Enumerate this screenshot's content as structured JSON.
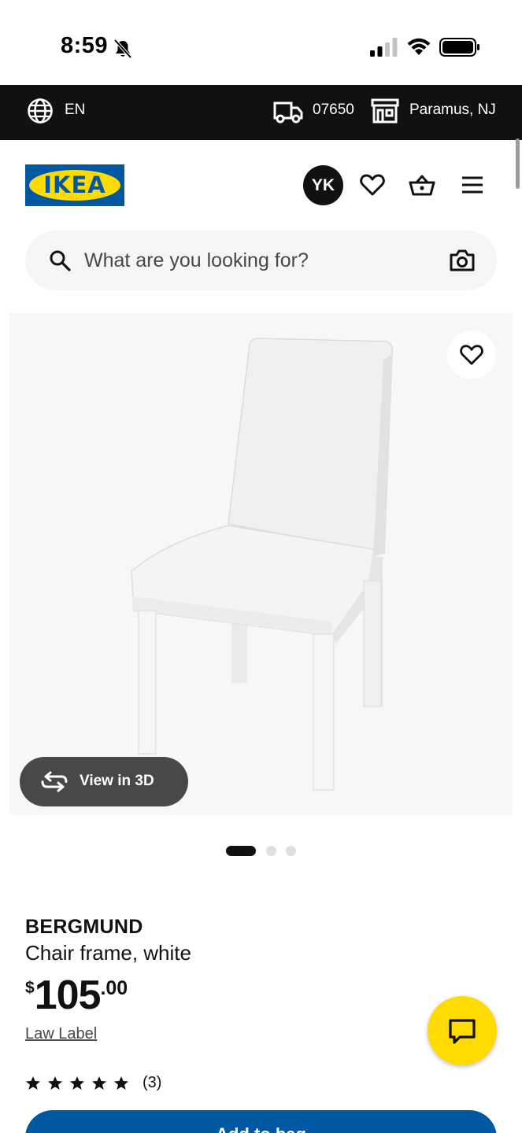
{
  "status_bar": {
    "time": "8:59"
  },
  "top_bar": {
    "language": "EN",
    "zip_code": "07650",
    "store": "Paramus, NJ"
  },
  "header": {
    "logo_text": "IKEA",
    "avatar_initials": "YK"
  },
  "search": {
    "placeholder": "What are you looking for?"
  },
  "product_image": {
    "view_3d_label": "View in 3D",
    "carousel_count": 3,
    "carousel_active": 1
  },
  "product": {
    "name": "BERGMUND",
    "description": "Chair frame, white",
    "price_currency": "$",
    "price_integer": "105",
    "price_decimal": ".00",
    "law_label": "Law Label",
    "rating": 5,
    "review_count": "(3)"
  },
  "actions": {
    "add_label": "Add to bag"
  },
  "icons": {
    "language": "globe-icon",
    "delivery": "truck-icon",
    "store": "store-icon",
    "wishlist": "heart-icon",
    "cart": "basket-icon",
    "menu": "hamburger-menu-icon",
    "search": "search-icon",
    "visual_search": "camera-icon",
    "view_3d": "rotate-3d-icon",
    "chat": "chat-icon"
  },
  "colors": {
    "brand_blue": "#0058a3",
    "brand_yellow": "#ffdb00",
    "top_bar": "#111111",
    "text_primary": "#111111",
    "text_secondary": "#484848"
  }
}
